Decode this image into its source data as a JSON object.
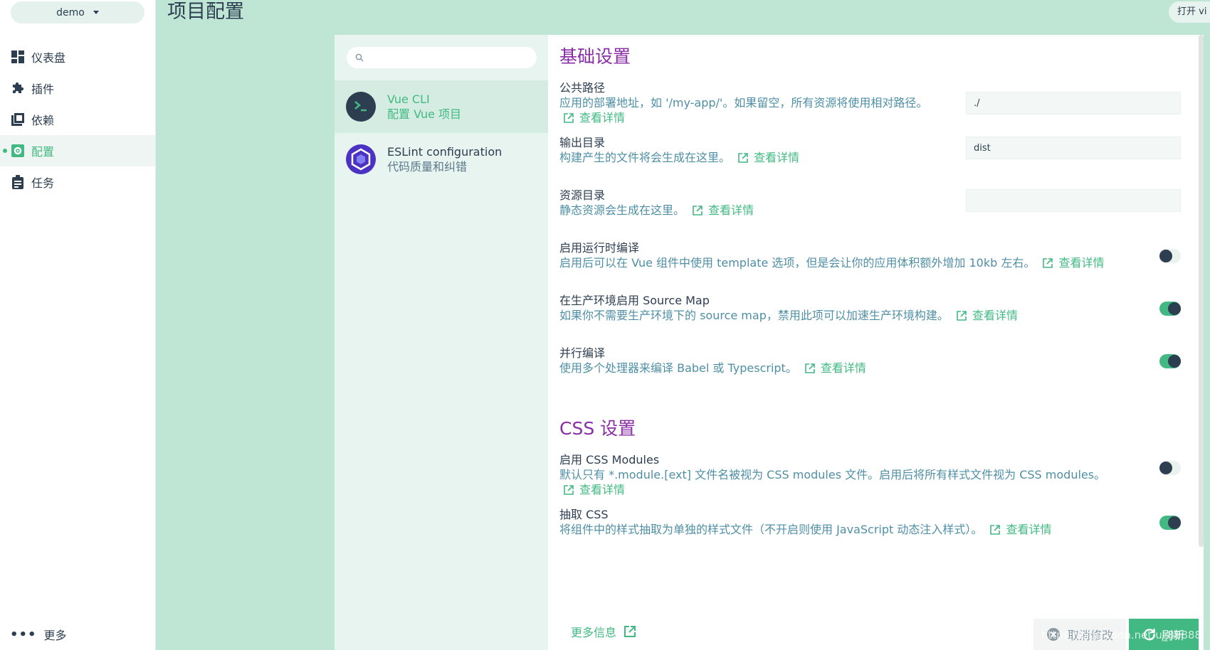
{
  "sidebar": {
    "project": "demo",
    "items": [
      {
        "label": "仪表盘",
        "icon": "dashboard-icon"
      },
      {
        "label": "插件",
        "icon": "puzzle-icon"
      },
      {
        "label": "依赖",
        "icon": "library-books-icon"
      },
      {
        "label": "配置",
        "icon": "settings-app-icon"
      },
      {
        "label": "任务",
        "icon": "clipboard-icon"
      }
    ],
    "active": "配置",
    "more": "更多"
  },
  "header": {
    "title": "项目配置",
    "open_button": "打开 vi"
  },
  "plugins": {
    "search_placeholder": "",
    "items": [
      {
        "name": "Vue CLI",
        "desc": "配置 Vue 项目",
        "icon": "vue-cli-icon"
      },
      {
        "name": "ESLint configuration",
        "desc": "代码质量和纠错",
        "icon": "eslint-icon"
      }
    ]
  },
  "sections": {
    "basic": {
      "title": "基础设置",
      "public_path": {
        "name": "公共路径",
        "desc": "应用的部署地址，如 '/my-app/'。如果留空，所有资源将使用相对路径。",
        "link": "查看详情",
        "value": "./"
      },
      "output_dir": {
        "name": "输出目录",
        "desc": "构建产生的文件将会生成在这里。",
        "link": "查看详情",
        "value": "dist"
      },
      "assets_dir": {
        "name": "资源目录",
        "desc": "静态资源会生成在这里。",
        "link": "查看详情",
        "value": ""
      },
      "runtime_compiler": {
        "name": "启用运行时编译",
        "desc": "启用后可以在 Vue 组件中使用 template 选项，但是会让你的应用体积额外增加 10kb 左右。",
        "link": "查看详情",
        "enabled": false
      },
      "source_map": {
        "name": "在生产环境启用 Source Map",
        "desc": "如果你不需要生产环境下的 source map，禁用此项可以加速生产环境构建。",
        "link": "查看详情",
        "enabled": true
      },
      "parallel": {
        "name": "并行编译",
        "desc": "使用多个处理器来编译 Babel 或 Typescript。",
        "link": "查看详情",
        "enabled": true
      }
    },
    "css": {
      "title": "CSS 设置",
      "modules": {
        "name": "启用 CSS Modules",
        "desc": "默认只有 *.module.[ext] 文件名被视为 CSS modules 文件。启用后将所有样式文件视为 CSS modules。",
        "link": "查看详情",
        "enabled": false
      },
      "extract": {
        "name": "抽取 CSS",
        "desc": "将组件中的样式抽取为单独的样式文件（不开启则使用 JavaScript 动态注入样式）。",
        "link": "查看详情",
        "enabled": true
      }
    }
  },
  "footer": {
    "more_info": "更多信息",
    "cancel": "取消修改",
    "refresh": "刷新"
  },
  "watermark": "https://blog.csdn.net/u_88888",
  "colors": {
    "accent": "#42b983",
    "section_title": "#8a2ea6",
    "main_bg": "#bfe6d5"
  }
}
